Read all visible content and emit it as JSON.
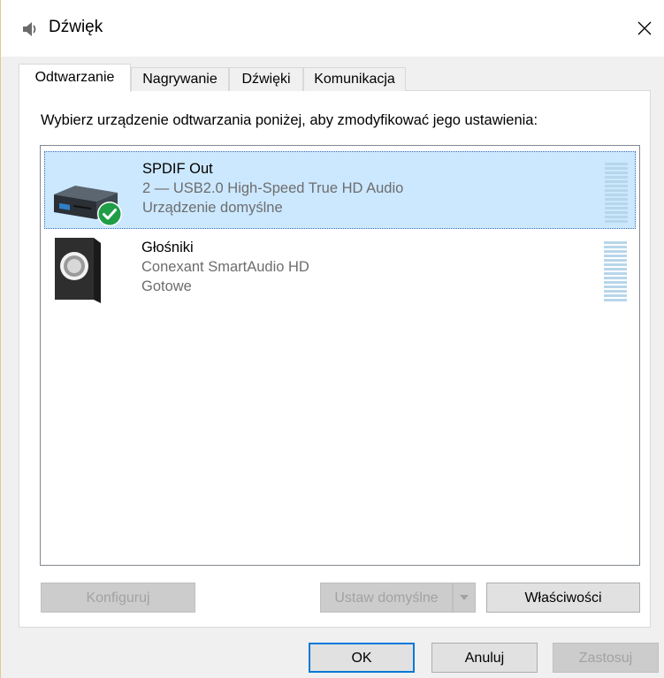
{
  "window": {
    "title": "Dźwięk",
    "icons": {
      "app": "speaker-icon",
      "close": "close-icon"
    }
  },
  "tabs": [
    {
      "label": "Odtwarzanie",
      "active": true
    },
    {
      "label": "Nagrywanie",
      "active": false
    },
    {
      "label": "Dźwięki",
      "active": false
    },
    {
      "label": "Komunikacja",
      "active": false
    }
  ],
  "playback": {
    "instruction": "Wybierz urządzenie odtwarzania poniżej, aby zmodyfikować jego ustawienia:",
    "devices": [
      {
        "name": "SPDIF Out",
        "description": "2 — USB2.0 High-Speed True HD Audio",
        "status": "Urządzenie domyślne",
        "icon": "spdif-device-icon",
        "badge": "default-check-icon",
        "selected": true
      },
      {
        "name": "Głośniki",
        "description": "Conexant SmartAudio HD",
        "status": "Gotowe",
        "icon": "speakers-icon",
        "selected": false
      }
    ]
  },
  "buttons": {
    "configure": "Konfiguruj",
    "set_default": "Ustaw domyślne",
    "properties": "Właściwości",
    "ok": "OK",
    "cancel": "Anuluj",
    "apply": "Zastosuj"
  },
  "colors": {
    "selection": "#cce8ff",
    "accent": "#0078d7",
    "check_badge": "#1f9d47"
  }
}
